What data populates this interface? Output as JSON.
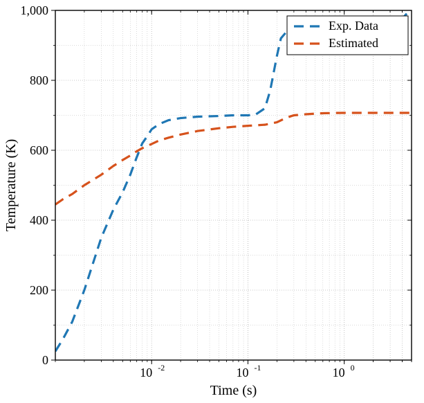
{
  "chart_data": {
    "type": "line",
    "title": "",
    "xlabel": "Time (s)",
    "ylabel": "Temperature (K)",
    "x_scale": "log",
    "xlim": [
      0.001,
      5
    ],
    "ylim": [
      0,
      1000
    ],
    "x_ticks_major": [
      0.01,
      0.1,
      1
    ],
    "x_tick_labels": [
      "10^{-2}",
      "10^{-1}",
      "10^{0}"
    ],
    "y_ticks_major": [
      0,
      200,
      400,
      600,
      800,
      1000
    ],
    "y_tick_labels": [
      "0",
      "200",
      "400",
      "600",
      "800",
      "1,000"
    ],
    "grid_minor": true,
    "grid_major": true,
    "legend_position": "top-right",
    "series": [
      {
        "name": "Exp. Data",
        "color": "#1f77b4",
        "style": "dashed",
        "x": [
          0.001,
          0.0012,
          0.0015,
          0.002,
          0.003,
          0.004,
          0.005,
          0.006,
          0.007,
          0.008,
          0.009,
          0.01,
          0.012,
          0.015,
          0.02,
          0.03,
          0.05,
          0.07,
          0.1,
          0.12,
          0.15,
          0.17,
          0.2,
          0.22,
          0.25,
          0.3,
          0.4,
          0.6,
          1,
          2,
          3.5,
          5
        ],
        "y": [
          25,
          60,
          110,
          200,
          350,
          430,
          480,
          530,
          580,
          620,
          640,
          660,
          675,
          686,
          692,
          696,
          698,
          700,
          700,
          702,
          720,
          770,
          870,
          920,
          938,
          940,
          940,
          940,
          940,
          942,
          960,
          1005
        ]
      },
      {
        "name": "Estimated",
        "color": "#d6521c",
        "style": "dashed",
        "x": [
          0.001,
          0.0012,
          0.0015,
          0.002,
          0.003,
          0.004,
          0.005,
          0.006,
          0.007,
          0.008,
          0.009,
          0.01,
          0.012,
          0.015,
          0.02,
          0.03,
          0.05,
          0.07,
          0.1,
          0.15,
          0.2,
          0.25,
          0.3,
          0.4,
          0.6,
          1,
          2,
          5
        ],
        "y": [
          445,
          460,
          475,
          500,
          530,
          555,
          572,
          585,
          597,
          606,
          612,
          618,
          628,
          636,
          645,
          655,
          663,
          667,
          670,
          673,
          680,
          693,
          700,
          703,
          706,
          707,
          707,
          707
        ]
      }
    ]
  },
  "legend": {
    "items": [
      {
        "label": "Exp. Data",
        "color": "#1f77b4"
      },
      {
        "label": "Estimated",
        "color": "#d6521c"
      }
    ]
  },
  "axes": {
    "xlabel": "Time (s)",
    "ylabel": "Temperature (K)"
  }
}
